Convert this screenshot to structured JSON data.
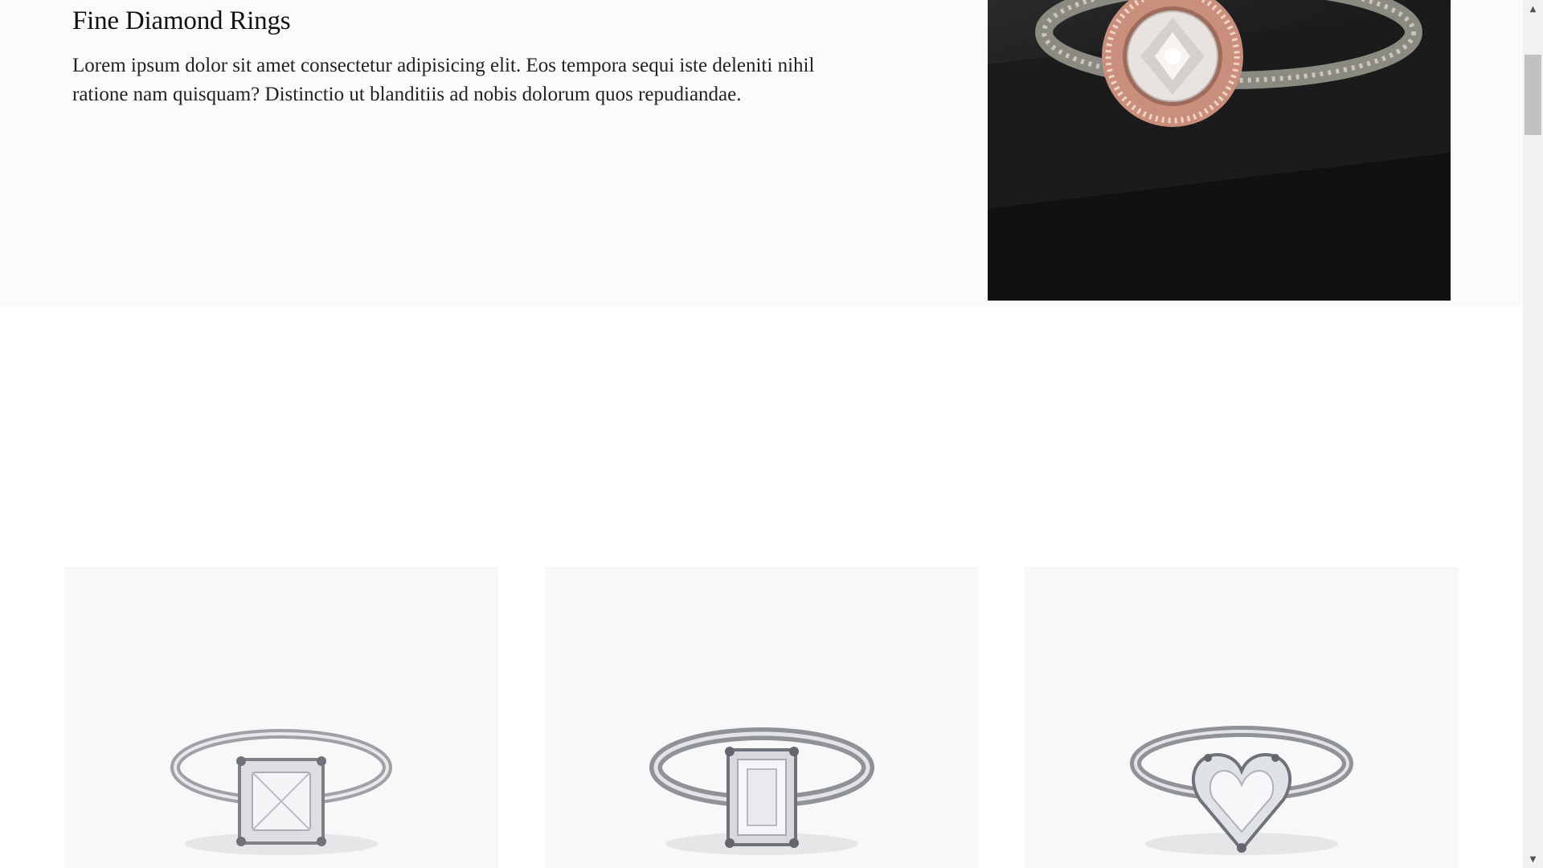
{
  "hero": {
    "title": "Fine Diamond Rings",
    "description": "Lorem ipsum dolor sit amet consectetur adipisicing elit. Eos tempora sequi iste deleniti nihil ratione nam quisquam? Distinctio ut blanditiis ad nobis dolorum quos repudiandae.",
    "image_icon": "rose-gold-halo-ring-image"
  },
  "products": [
    {
      "icon": "radiant-cut-ring-image"
    },
    {
      "icon": "emerald-cut-ring-image"
    },
    {
      "icon": "heart-cut-ring-image"
    }
  ],
  "scrollbar": {
    "up_glyph": "▲",
    "down_glyph": "▼"
  },
  "colors": {
    "hero_bg": "#fbfbfb",
    "card_bg": "#f8f8f9",
    "rose_gold": "#d59a86",
    "dark_display": "#151515"
  }
}
